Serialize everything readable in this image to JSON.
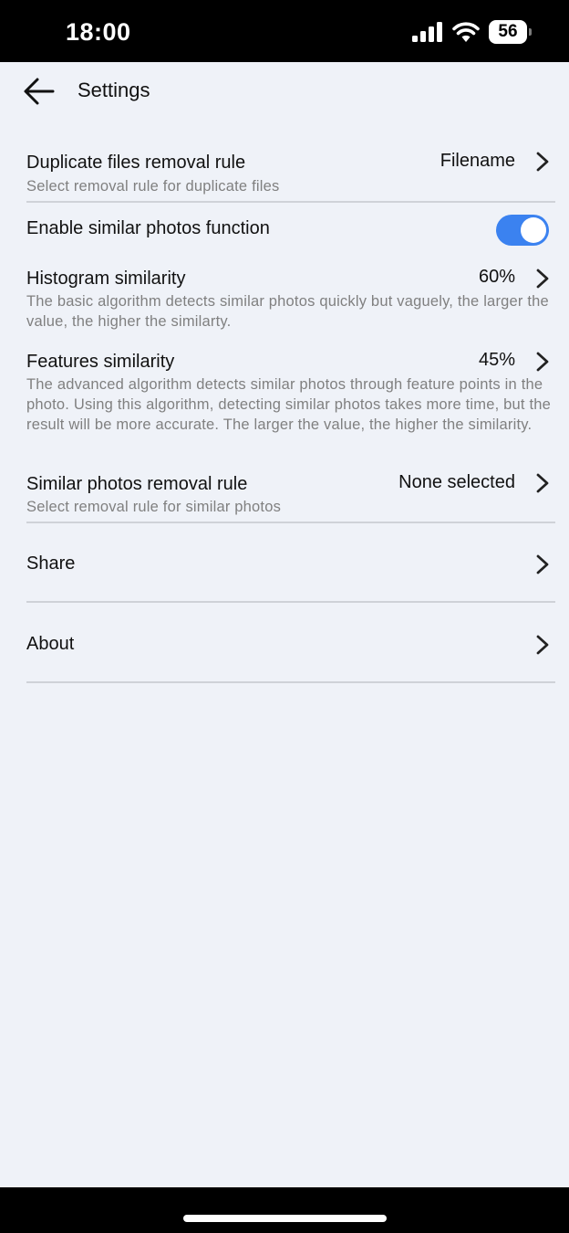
{
  "status_bar": {
    "time": "18:00",
    "battery": "56"
  },
  "app_bar": {
    "title": "Settings"
  },
  "settings": {
    "duplicate_rule": {
      "title": "Duplicate files removal rule",
      "value": "Filename",
      "description": "Select removal rule for duplicate files"
    },
    "similar_photos_toggle": {
      "title": "Enable similar photos function",
      "enabled": true
    },
    "histogram": {
      "title": "Histogram similarity",
      "value": "60%",
      "description": "The basic algorithm detects similar photos quickly but vaguely, the larger the value, the higher the similarty."
    },
    "features": {
      "title": "Features similarity",
      "value": "45%",
      "description": "The advanced algorithm detects similar photos through feature points in the photo. Using this algorithm, detecting similar photos takes more time, but the result will be more accurate. The larger the value, the higher the similarity."
    },
    "similar_rule": {
      "title": "Similar photos removal rule",
      "value": "None selected",
      "description": "Select removal rule for similar photos"
    },
    "share": {
      "title": "Share"
    },
    "about": {
      "title": "About"
    }
  },
  "colors": {
    "background": "#eff2f8",
    "accent": "#3b82f0",
    "secondary_text": "#808080"
  },
  "icons": {
    "back": "arrow-left-icon",
    "chevron": "chevron-right-icon",
    "signal": "cellular-signal-icon",
    "wifi": "wifi-icon",
    "battery": "battery-icon"
  }
}
